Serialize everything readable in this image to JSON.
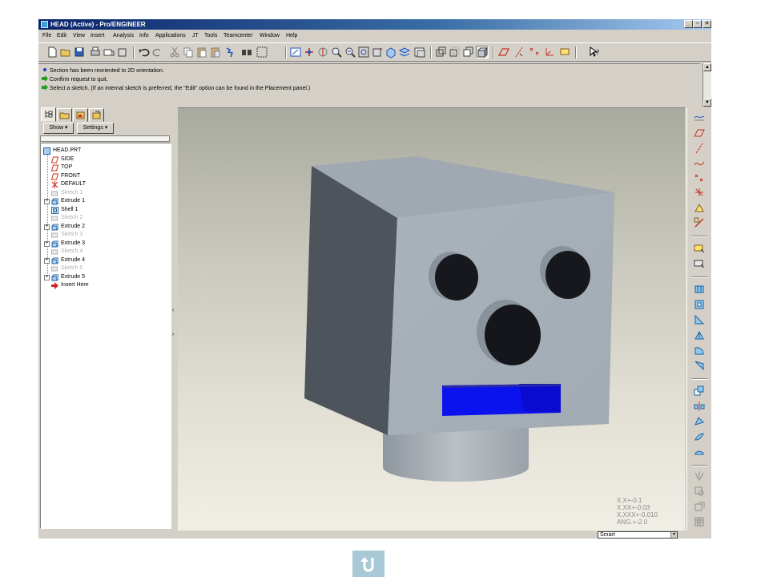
{
  "window": {
    "title": "HEAD (Active) - Pro/ENGINEER",
    "controls": {
      "minimize": "_",
      "restore": "▫",
      "close": "✕"
    }
  },
  "menu": [
    "File",
    "Edit",
    "View",
    "Insert",
    "Analysis",
    "Info",
    "Applications",
    "JT",
    "Tools",
    "Teamcenter",
    "Window",
    "Help"
  ],
  "toolbar_icons": [
    "new-file-icon",
    "open-folder-icon",
    "save-icon",
    "print-icon",
    "email-icon",
    "undo-icon",
    "redo-icon",
    "cut-icon",
    "copy-icon",
    "paste-icon",
    "paste-special-icon",
    "regenerate-icon",
    "find-icon",
    "selection-box-icon",
    "repaint-icon",
    "spin-center-icon",
    "orient-icon",
    "zoom-in-icon",
    "zoom-out-icon",
    "refit-icon",
    "reorient-icon",
    "saved-views-icon",
    "layers-icon",
    "wireframe-icon",
    "hidden-line-icon",
    "no-hidden-icon",
    "shading-icon",
    "datum-planes-icon",
    "datum-axes-icon",
    "datum-points-icon",
    "coordinate-systems-icon",
    "whats-this-icon"
  ],
  "messages": [
    {
      "icon": "info-bullet-icon",
      "text": "Section has been reoriented to 2D orientation."
    },
    {
      "icon": "prompt-arrow-icon",
      "text": "Confirm request to quit."
    },
    {
      "icon": "prompt-arrow-icon",
      "text": "Select a sketch. (If an internal sketch is preferred, the \"Edit\" option can be found in the Placement panel.)"
    }
  ],
  "tree": {
    "show_label": "Show ▾",
    "settings_label": "Settings ▾",
    "items": [
      {
        "label": "HEAD.PRT",
        "icon": "part-icon",
        "level": 0,
        "expand": false,
        "suppressed": false
      },
      {
        "label": "SIDE",
        "icon": "datum-plane-icon",
        "level": 1,
        "expand": false,
        "suppressed": false
      },
      {
        "label": "TOP",
        "icon": "datum-plane-icon",
        "level": 1,
        "expand": false,
        "suppressed": false
      },
      {
        "label": "FRONT",
        "icon": "datum-plane-icon",
        "level": 1,
        "expand": false,
        "suppressed": false
      },
      {
        "label": "DEFAULT",
        "icon": "coordinate-system-icon",
        "level": 1,
        "expand": false,
        "suppressed": false
      },
      {
        "label": "Sketch 1",
        "icon": "sketch-icon",
        "level": 1,
        "expand": false,
        "suppressed": true
      },
      {
        "label": "Extrude 1",
        "icon": "extrude-icon",
        "level": 1,
        "expand": true,
        "suppressed": false
      },
      {
        "label": "Shell 1",
        "icon": "shell-icon",
        "level": 1,
        "expand": false,
        "suppressed": false
      },
      {
        "label": "Sketch 2",
        "icon": "sketch-icon",
        "level": 1,
        "expand": false,
        "suppressed": true
      },
      {
        "label": "Extrude 2",
        "icon": "extrude-icon",
        "level": 1,
        "expand": true,
        "suppressed": false
      },
      {
        "label": "Sketch 3",
        "icon": "sketch-icon",
        "level": 1,
        "expand": false,
        "suppressed": true
      },
      {
        "label": "Extrude 3",
        "icon": "extrude-icon",
        "level": 1,
        "expand": true,
        "suppressed": false
      },
      {
        "label": "Sketch 4",
        "icon": "sketch-icon",
        "level": 1,
        "expand": false,
        "suppressed": true
      },
      {
        "label": "Extrude 4",
        "icon": "extrude-icon",
        "level": 1,
        "expand": true,
        "suppressed": false
      },
      {
        "label": "Sketch 5",
        "icon": "sketch-icon",
        "level": 1,
        "expand": false,
        "suppressed": true
      },
      {
        "label": "Extrude 5",
        "icon": "extrude-icon",
        "level": 1,
        "expand": true,
        "suppressed": false
      },
      {
        "label": "Insert Here",
        "icon": "insert-here-arrow-icon",
        "level": 1,
        "expand": false,
        "suppressed": false
      }
    ]
  },
  "tolerances": [
    "X.X+-0.1",
    "X.XX+-0.03",
    "X.XXX+-0.010",
    "ANG.+-2.0"
  ],
  "right_toolbar_icons": [
    "datum-plane-tool-icon",
    "datum-axis-tool-icon",
    "datum-curve-tool-icon",
    "sketched-curve-icon",
    "datum-point-tool-icon",
    "coordinate-system-tool-icon",
    "analysis-feature-icon",
    "sketch-tool-icon",
    "extrude-tool-icon",
    "revolve-tool-icon",
    "hole-tool-icon",
    "shell-tool-icon",
    "rib-tool-icon",
    "draft-tool-icon",
    "round-tool-icon",
    "chamfer-tool-icon",
    "copy-tool-icon",
    "mirror-tool-icon",
    "merge-tool-icon",
    "trim-tool-icon",
    "pattern-tool-icon"
  ],
  "filter": {
    "value": "Smart"
  },
  "colors": {
    "model_gray": "#a7b0b8",
    "model_side": "#4e555d",
    "feature_blue": "#0a10e8",
    "eye_black": "#15161c"
  },
  "return_button": {
    "icon": "return-u-turn-icon"
  }
}
